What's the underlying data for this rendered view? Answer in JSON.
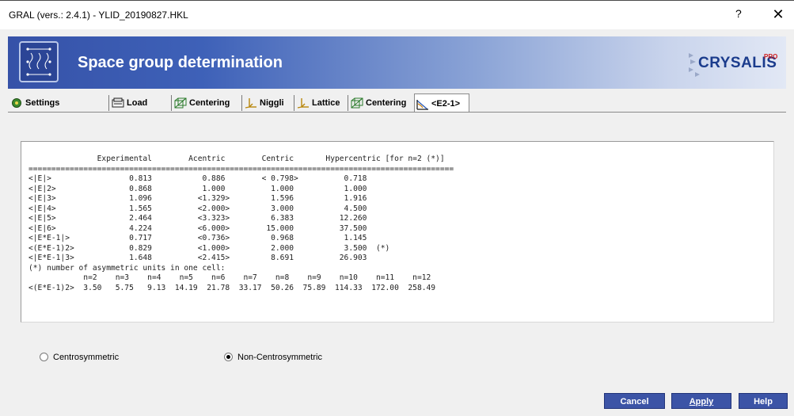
{
  "window": {
    "title": "GRAL (vers.: 2.4.1) - YLID_20190827.HKL",
    "help": "?",
    "close": "✕"
  },
  "banner": {
    "heading": "Space group determination",
    "brand": "CRYSALIS",
    "brand_suffix": "PRO"
  },
  "tabs": [
    {
      "label": "Settings",
      "icon": "settings-icon"
    },
    {
      "label": "Load",
      "icon": "load-icon"
    },
    {
      "label": "Centering",
      "icon": "centering-icon"
    },
    {
      "label": "Niggli",
      "icon": "niggli-icon"
    },
    {
      "label": "Lattice",
      "icon": "lattice-icon"
    },
    {
      "label": "Centering",
      "icon": "centering-icon"
    },
    {
      "label": "<E2-1>",
      "icon": "e2-icon",
      "active": true
    }
  ],
  "stats": {
    "header": "               Experimental        Acentric        Centric       Hypercentric [for n=2 (*)]",
    "separator": "=============================================================================================",
    "rows": [
      "<|E|>                 0.813           0.886        < 0.798>          0.718",
      "<|E|2>                0.868           1.000          1.000           1.000",
      "<|E|3>                1.096          <1.329>         1.596           1.916",
      "<|E|4>                1.565          <2.000>         3.000           4.500",
      "<|E|5>                2.464          <3.323>         6.383          12.260",
      "<|E|6>                4.224          <6.000>        15.000          37.500",
      "<|E*E-1|>             0.717          <0.736>         0.968           1.145",
      "<(E*E-1)2>            0.829          <1.000>         2.000           3.500  (*)",
      "<|E*E-1|3>            1.648          <2.415>         8.691          26.903"
    ],
    "note": "(*) number of asymmetric units in one cell:",
    "n_header": "            n=2    n=3    n=4    n=5    n=6    n=7    n=8    n=9    n=10    n=11    n=12",
    "n_values": "<(E*E-1)2>  3.50   5.75   9.13  14.19  21.78  33.17  50.26  75.89  114.33  172.00  258.49"
  },
  "options": {
    "centro": "Centrosymmetric",
    "noncentro": "Non-Centrosymmetric",
    "selected": "noncentro"
  },
  "buttons": {
    "cancel": "Cancel",
    "apply": "Apply",
    "help": "Help"
  }
}
